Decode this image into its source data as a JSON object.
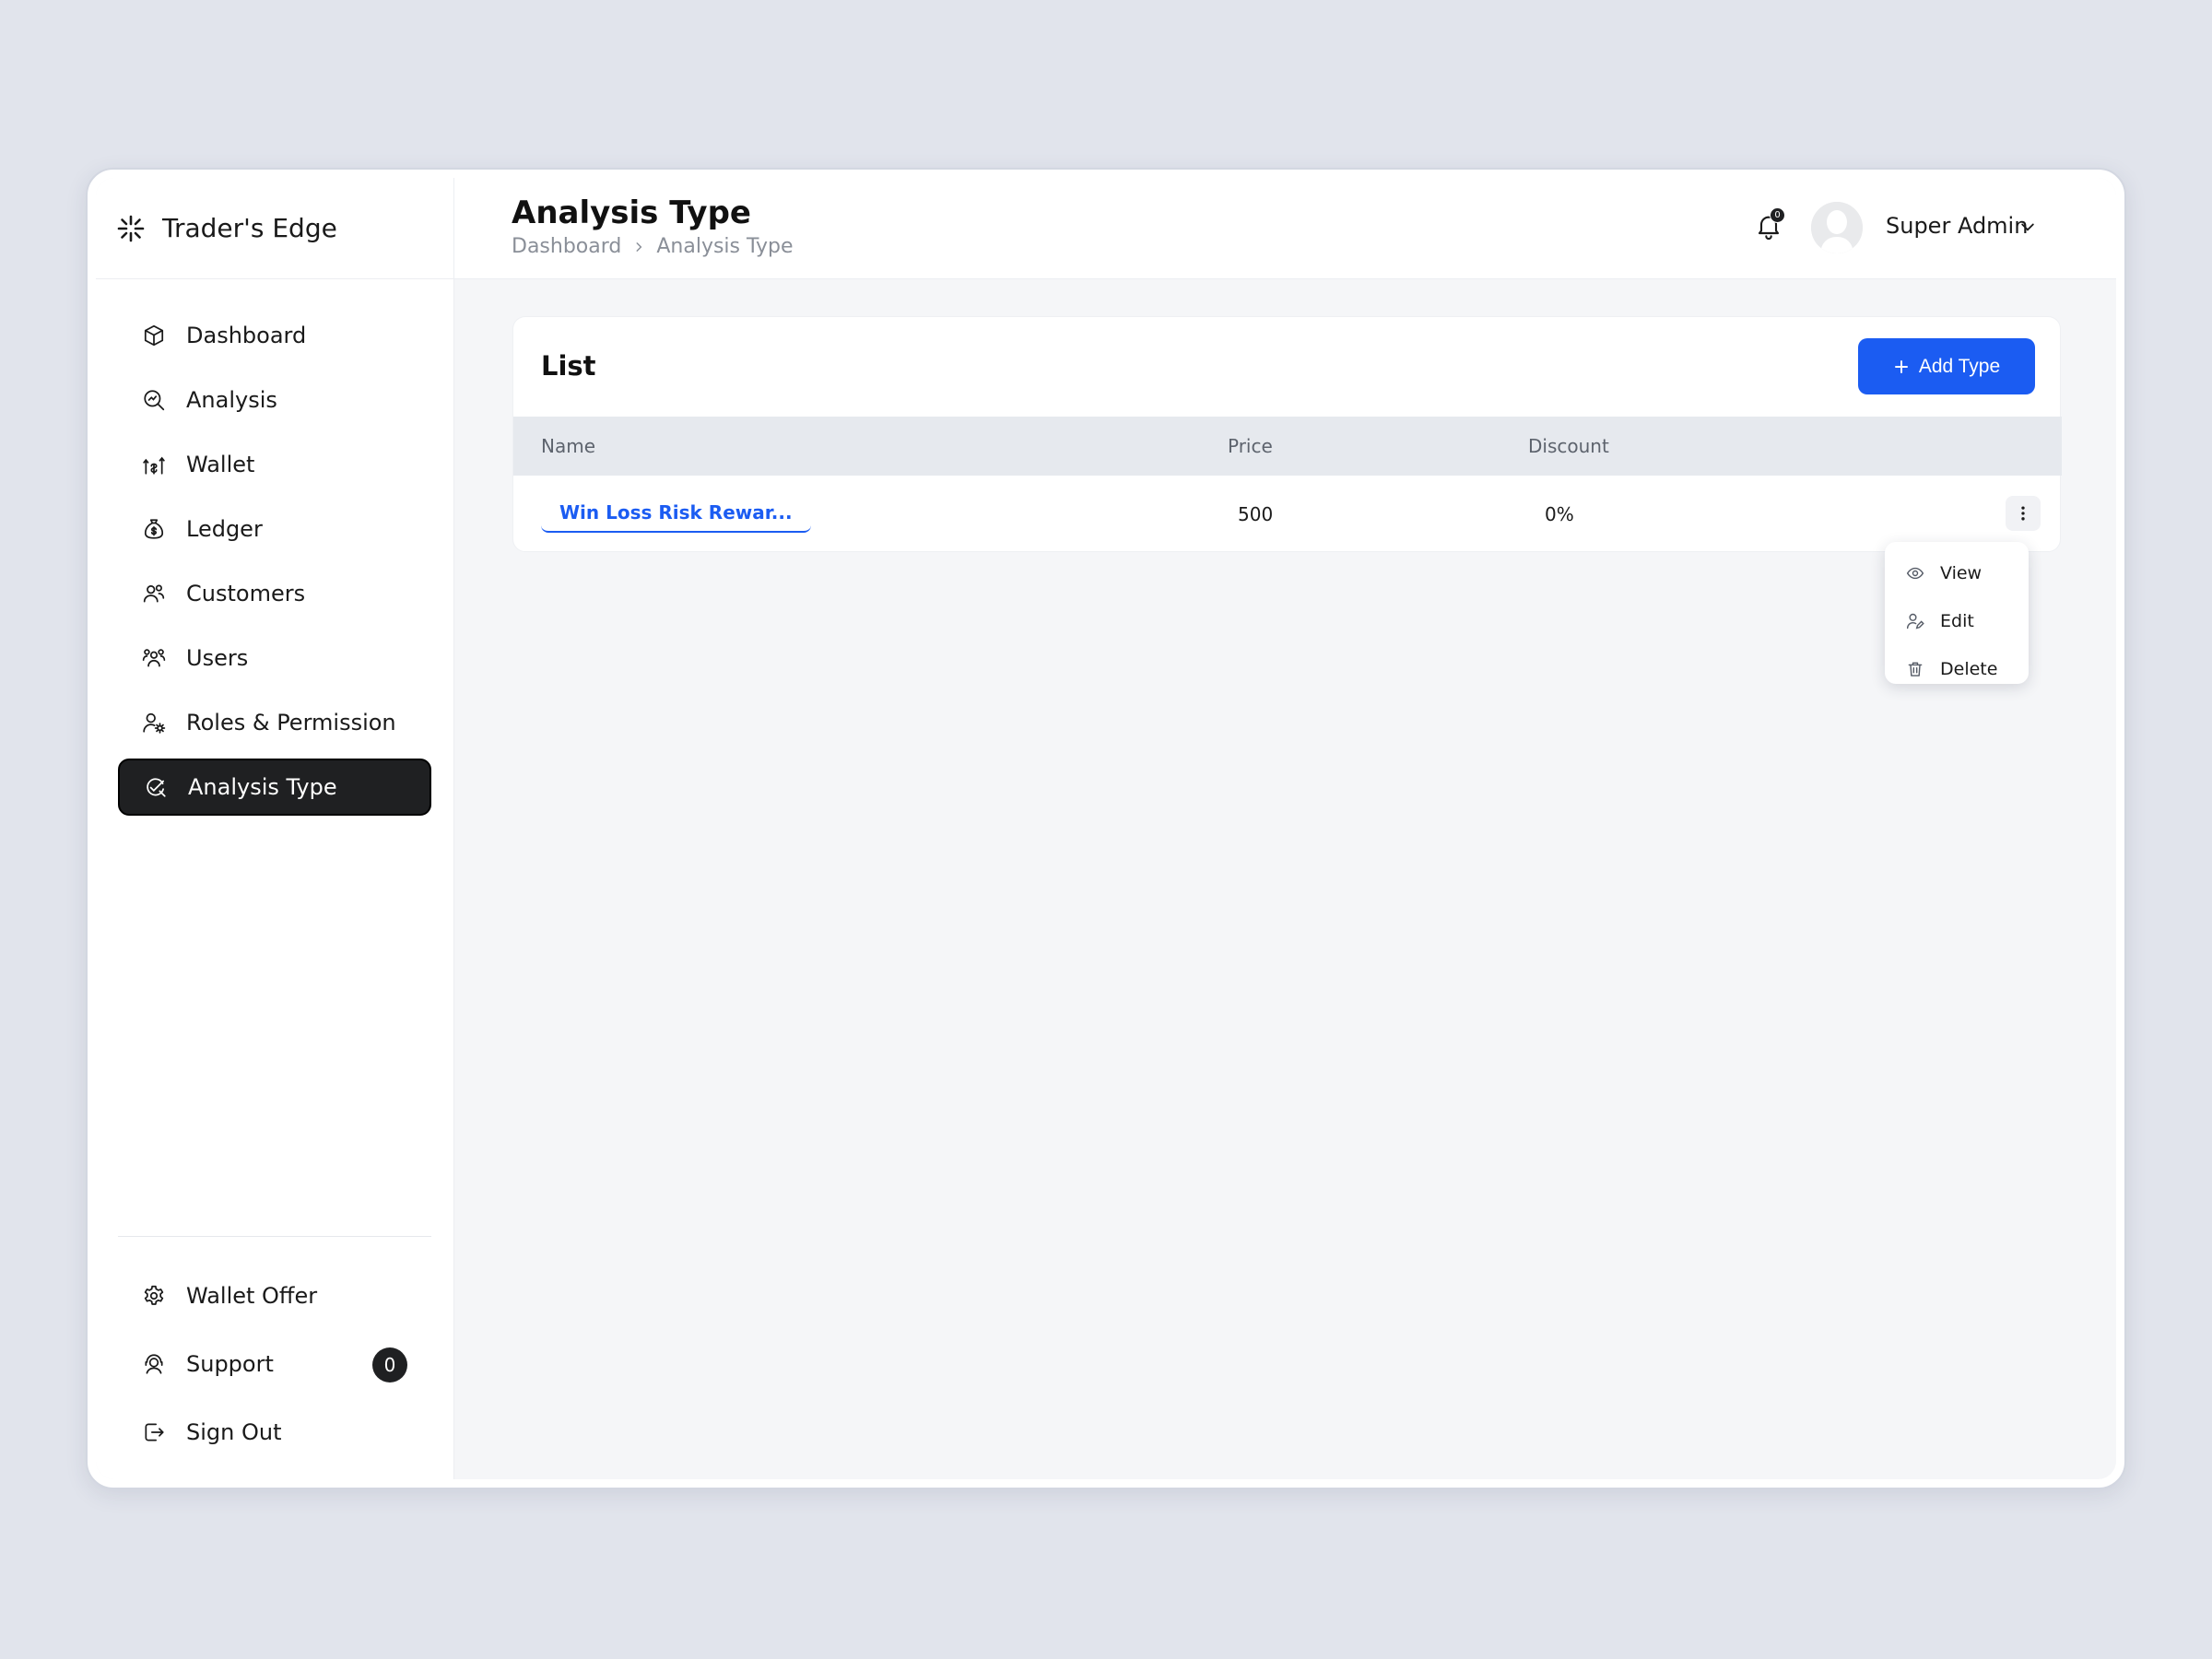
{
  "brand": {
    "name": "Trader's Edge",
    "icon": "asterisk-logo-icon"
  },
  "sidebar": {
    "items": [
      {
        "label": "Dashboard",
        "icon": "cube-icon",
        "active": false
      },
      {
        "label": "Analysis",
        "icon": "search-analytics-icon",
        "active": false
      },
      {
        "label": "Wallet",
        "icon": "wallet-transfer-icon",
        "active": false
      },
      {
        "label": "Ledger",
        "icon": "money-bag-icon",
        "active": false
      },
      {
        "label": "Customers",
        "icon": "customers-icon",
        "active": false
      },
      {
        "label": "Users",
        "icon": "users-icon",
        "active": false
      },
      {
        "label": "Roles & Permission",
        "icon": "user-gear-icon",
        "active": false
      },
      {
        "label": "Analysis Type",
        "icon": "analysis-type-icon",
        "active": true
      }
    ],
    "bottom": [
      {
        "label": "Wallet Offer",
        "icon": "gear-icon"
      },
      {
        "label": "Support",
        "icon": "support-agent-icon",
        "badge": "0"
      },
      {
        "label": "Sign Out",
        "icon": "sign-out-icon"
      }
    ]
  },
  "header": {
    "title": "Analysis Type",
    "breadcrumb": [
      "Dashboard",
      "Analysis Type"
    ],
    "notifications": "0",
    "user": "Super Admin"
  },
  "list": {
    "title": "List",
    "add_label": "Add Type",
    "columns": {
      "name": "Name",
      "price": "Price",
      "discount": "Discount"
    },
    "rows": [
      {
        "name": "Win Loss Risk Rewar...",
        "price": "500",
        "discount": "0%"
      }
    ]
  },
  "row_menu": {
    "items": [
      {
        "label": "View",
        "icon": "eye-icon"
      },
      {
        "label": "Edit",
        "icon": "user-edit-icon"
      },
      {
        "label": "Delete",
        "icon": "trash-icon"
      }
    ]
  },
  "colors": {
    "primary": "#1b5cf2",
    "active_nav": "#1f2022",
    "background": "#e1e4ec"
  }
}
